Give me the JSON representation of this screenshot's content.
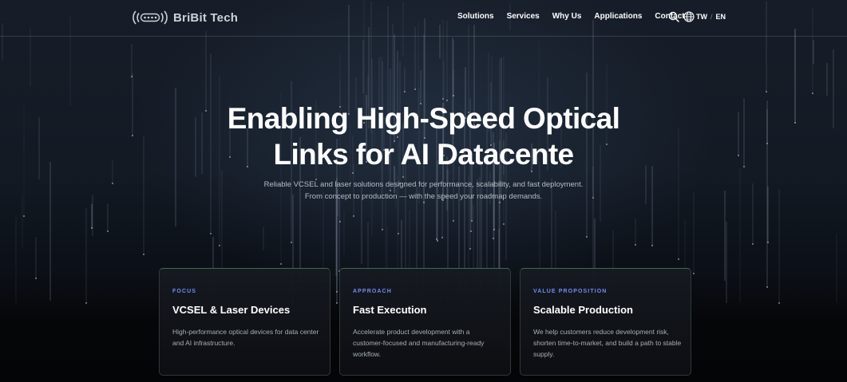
{
  "brand": {
    "name": "BriBit Tech",
    "logo_icon": "signal-dots-logo"
  },
  "nav": {
    "links": [
      "Solutions",
      "Services",
      "Why Us",
      "Applications",
      "Contact"
    ],
    "search_icon": "search-icon",
    "globe_icon": "globe-icon",
    "languages": [
      "TW",
      "EN"
    ],
    "language_separator": "/"
  },
  "hero": {
    "title_line1": "Enabling High-Speed Optical",
    "title_line2": "Links for AI Datacente",
    "subtitle_line1": "Reliable VCSEL and laser solutions designed for performance, scalability, and fast deployment.",
    "subtitle_line2": "From concept to production — with the speed your roadmap demands."
  },
  "cards": [
    {
      "eyebrow": "FOCUS",
      "title": "VCSEL & Laser Devices",
      "body": "High-performance optical devices for data center and AI infrastructure."
    },
    {
      "eyebrow": "APPROACH",
      "title": "Fast Execution",
      "body": "Accelerate product development with a customer-focused and manufacturing-ready workflow."
    },
    {
      "eyebrow": "VALUE PROPOSITION",
      "title": "Scalable Production",
      "body": "We help customers reduce development risk, shorten time-to-market, and build a path to stable supply."
    }
  ],
  "colors": {
    "accent": "#6f8df2",
    "card_border": "#3e6a55",
    "background": "#06090e"
  }
}
